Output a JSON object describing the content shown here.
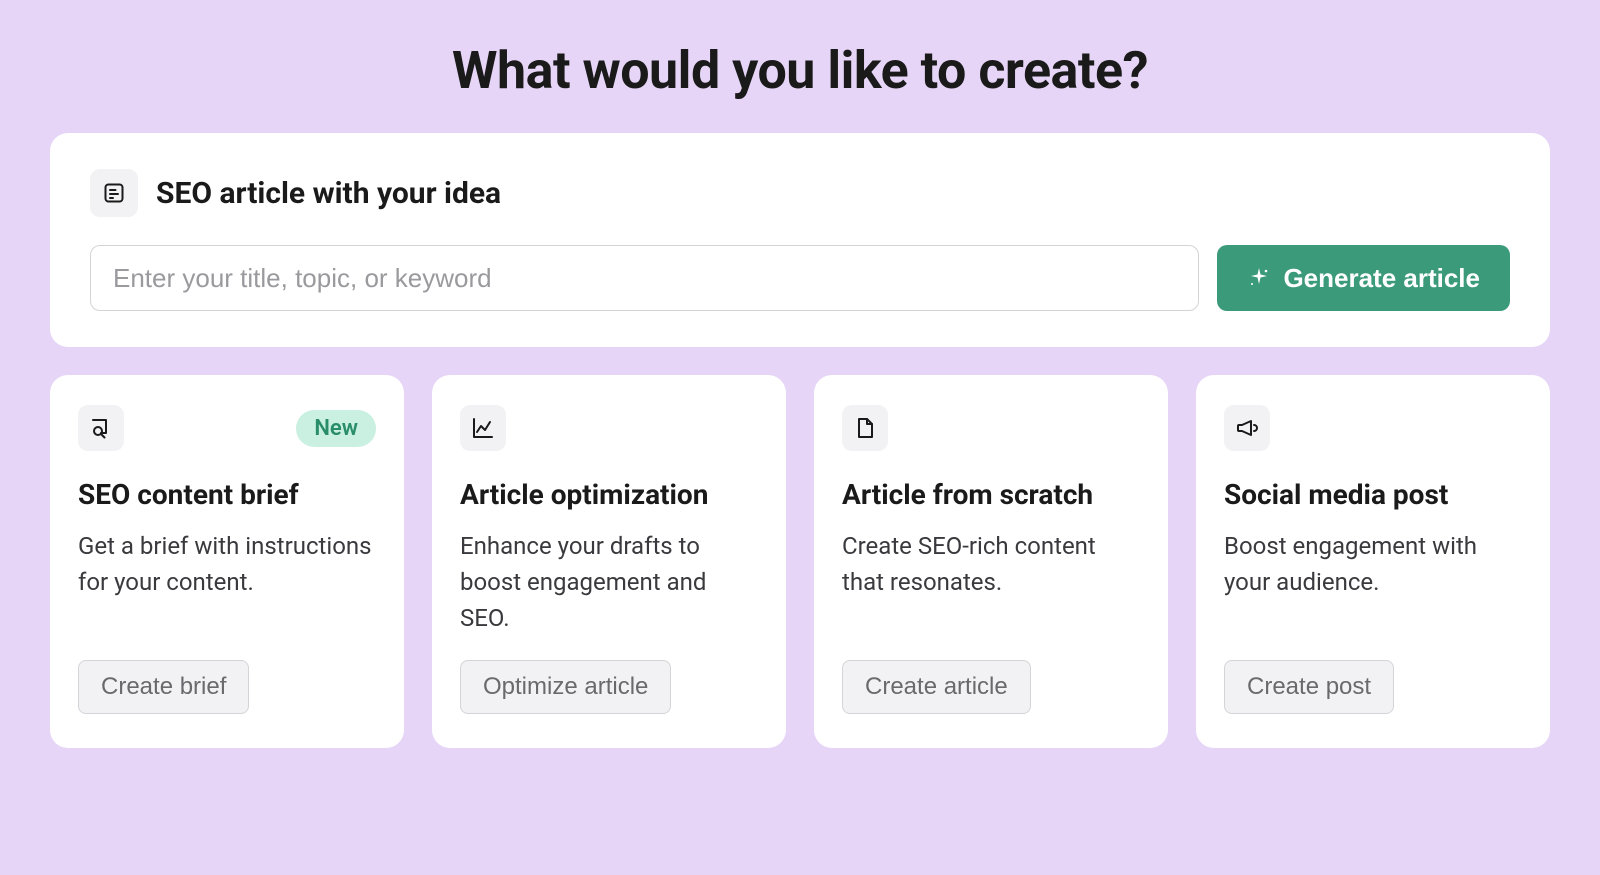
{
  "page": {
    "title": "What would you like to create?"
  },
  "hero": {
    "title": "SEO article with your idea",
    "input_placeholder": "Enter your title, topic, or keyword",
    "generate_label": "Generate article"
  },
  "cards": [
    {
      "title": "SEO content brief",
      "desc": "Get a brief with instructions for your content.",
      "button": "Create brief",
      "badge": "New"
    },
    {
      "title": "Article optimization",
      "desc": "Enhance your drafts to boost engagement and SEO.",
      "button": "Optimize article",
      "badge": null
    },
    {
      "title": "Article from scratch",
      "desc": "Create SEO-rich content that resonates.",
      "button": "Create article",
      "badge": null
    },
    {
      "title": "Social media post",
      "desc": "Boost engagement with your audience.",
      "button": "Create post",
      "badge": null
    }
  ]
}
